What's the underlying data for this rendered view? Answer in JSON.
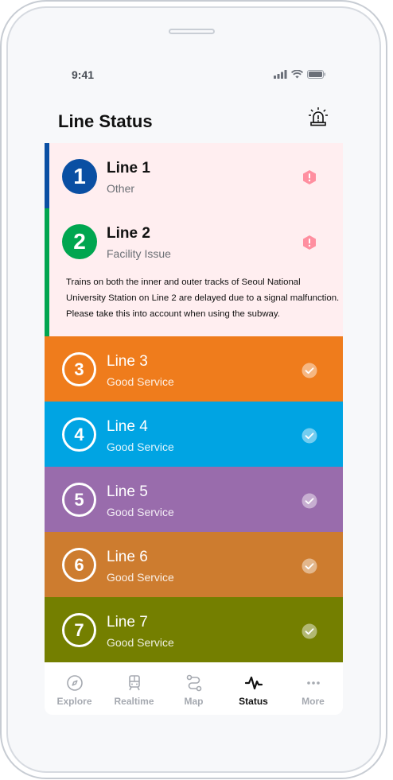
{
  "status_bar": {
    "time": "9:41"
  },
  "header": {
    "title": "Line Status",
    "alarm_icon": "siren-icon"
  },
  "lines": [
    {
      "number": "1",
      "name": "Line 1",
      "status": "Other",
      "state": "alert",
      "color": "#0a4fa3",
      "badge_style": "filled"
    },
    {
      "number": "2",
      "name": "Line 2",
      "status": "Facility Issue",
      "state": "alert",
      "color": "#00a650",
      "badge_style": "filled",
      "message": "Trains on both the inner and outer tracks of Seoul National University Station on Line 2 are delayed due to a signal malfunction. Please take this into account when using the subway."
    },
    {
      "number": "3",
      "name": "Line 3",
      "status": "Good Service",
      "state": "good",
      "color": "#ef7c1c",
      "badge_style": "outlined"
    },
    {
      "number": "4",
      "name": "Line 4",
      "status": "Good Service",
      "state": "good",
      "color": "#00a4e3",
      "badge_style": "outlined"
    },
    {
      "number": "5",
      "name": "Line 5",
      "status": "Good Service",
      "state": "good",
      "color": "#996cac",
      "badge_style": "outlined"
    },
    {
      "number": "6",
      "name": "Line 6",
      "status": "Good Service",
      "state": "good",
      "color": "#cd7c2f",
      "badge_style": "outlined"
    },
    {
      "number": "7",
      "name": "Line 7",
      "status": "Good Service",
      "state": "good",
      "color": "#747f00",
      "badge_style": "outlined"
    }
  ],
  "colors": {
    "alert_bg": "#ffeef0",
    "alert_icon": "#ff8fa0",
    "active_tab": "#111111",
    "inactive_tab": "#a5a9b0"
  },
  "tabs": [
    {
      "label": "Explore",
      "icon": "compass-icon",
      "active": false
    },
    {
      "label": "Realtime",
      "icon": "train-icon",
      "active": false
    },
    {
      "label": "Map",
      "icon": "route-icon",
      "active": false
    },
    {
      "label": "Status",
      "icon": "pulse-icon",
      "active": true
    },
    {
      "label": "More",
      "icon": "more-dots-icon",
      "active": false
    }
  ]
}
